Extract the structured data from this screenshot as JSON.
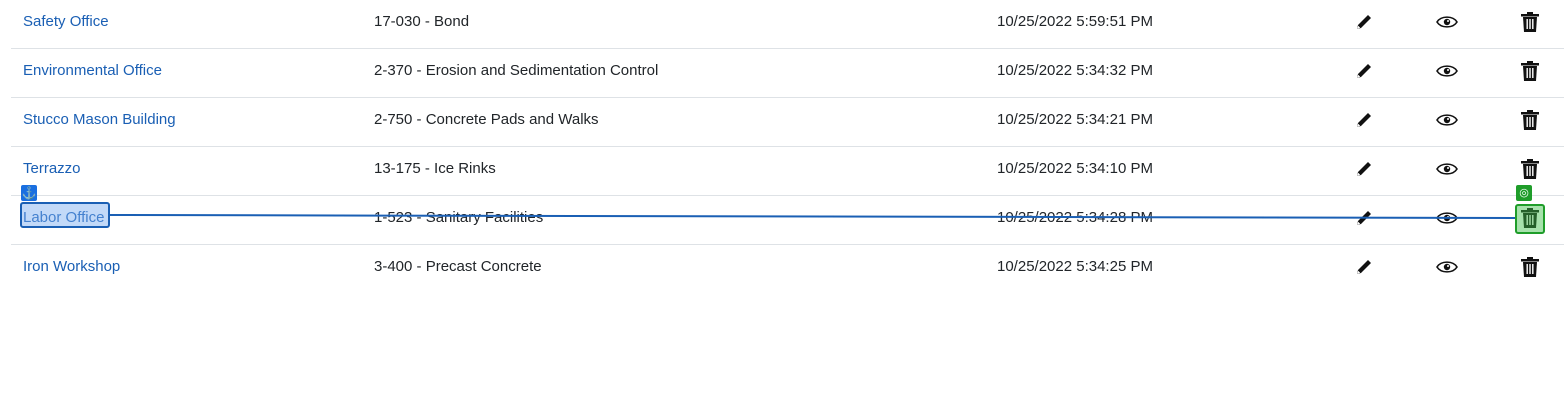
{
  "rows": [
    {
      "name": "Safety Office",
      "code": "17-030 - Bond",
      "date": "10/25/2022 5:59:51 PM"
    },
    {
      "name": "Environmental Office",
      "code": "2-370 - Erosion and Sedimentation Control",
      "date": "10/25/2022 5:34:32 PM"
    },
    {
      "name": "Stucco Mason Building",
      "code": "2-750 - Concrete Pads and Walks",
      "date": "10/25/2022 5:34:21 PM"
    },
    {
      "name": "Terrazzo",
      "code": "13-175 - Ice Rinks",
      "date": "10/25/2022 5:34:10 PM"
    },
    {
      "name": "Labor Office",
      "code": "1-523 - Sanitary Facilities",
      "date": "10/25/2022 5:34:28 PM"
    },
    {
      "name": "Iron Workshop",
      "code": "3-400 - Precast Concrete",
      "date": "10/25/2022 5:34:25 PM"
    }
  ],
  "row_actions": [
    "pencil-icon",
    "eye-icon",
    "trash-icon"
  ],
  "overlay": {
    "anchor_icon": "anchor-icon",
    "target_icon": "target-icon",
    "colors": {
      "anchor": "#1a6fe0",
      "target": "#1f9d2a"
    }
  },
  "colors": {
    "link": "#1a5fb4",
    "text": "#212529",
    "divider": "#dee2e6"
  }
}
